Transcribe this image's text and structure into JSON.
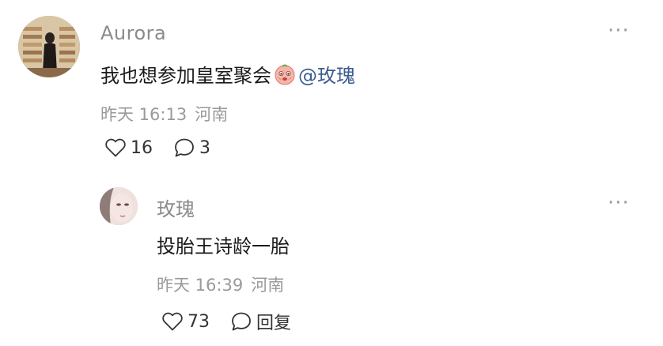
{
  "comment": {
    "username": "Aurora",
    "text": "我也想参加皇室聚会",
    "emoji": "peach-face-emoji",
    "mention": "@玫瑰",
    "time": "昨天 16:13",
    "location": "河南",
    "likes": "16",
    "replies": "3",
    "more": "···"
  },
  "reply": {
    "username": "玫瑰",
    "text": "投胎王诗龄一胎",
    "time": "昨天 16:39",
    "location": "河南",
    "likes": "73",
    "reply_label": "回复",
    "more": "···"
  },
  "colors": {
    "username": "#8b8b8b",
    "meta": "#9a9a9a",
    "mention": "#3b5c8f",
    "text": "#1a1a1a"
  }
}
